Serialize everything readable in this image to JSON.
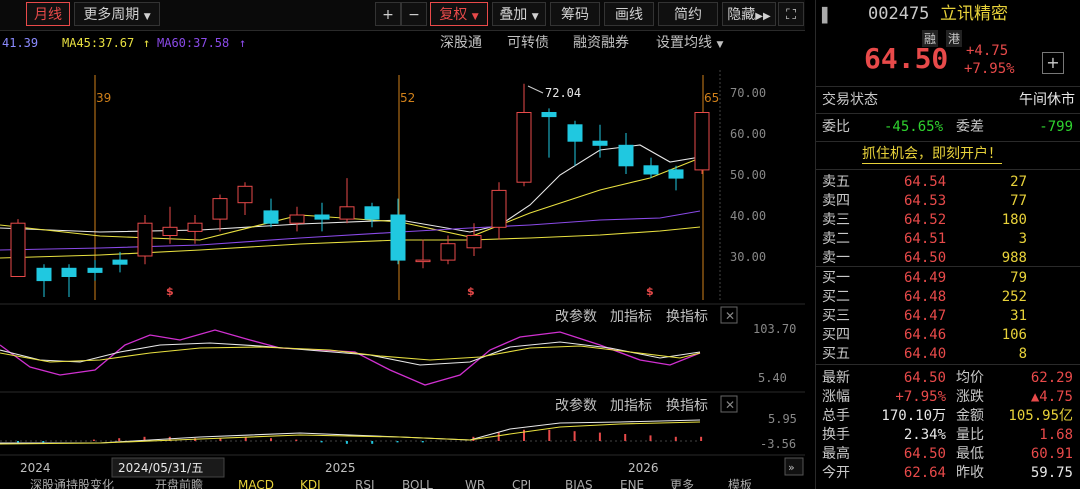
{
  "toolbar": {
    "tab_monthly": "月线",
    "more_periods": "更多周期",
    "plus": "+",
    "minus": "−",
    "fuquan": "复权",
    "diejia": "叠加",
    "chouma": "筹码",
    "huaxian": "画线",
    "jianyue": "简约",
    "yincang": "隐藏",
    "fullscreen": "⛶"
  },
  "ma_line": {
    "ma_prev": "41.39",
    "ma45": "MA45:37.67",
    "ma60": "MA60:37.58",
    "links": [
      "深股通",
      "可转债",
      "融资融券",
      "设置均线"
    ]
  },
  "chart": {
    "price_ticks": [
      "70.00",
      "60.00",
      "50.00",
      "40.00",
      "30.00"
    ],
    "markers": [
      "39",
      "52",
      "65"
    ],
    "peak_label": "72.04",
    "indicator1": {
      "top": "103.70",
      "bottom": "5.40",
      "buttons": [
        "改参数",
        "加指标",
        "换指标"
      ]
    },
    "indicator2": {
      "top": "5.95",
      "bottom": "-3.56",
      "buttons": [
        "改参数",
        "加指标",
        "换指标"
      ]
    },
    "x_axis": [
      "2024",
      "2024/05/31/五",
      "2025",
      "2026"
    ]
  },
  "bottom_tabs": [
    "深股通持股变化",
    "开盘前瞻",
    "MACD",
    "KDJ",
    "RSI",
    "BOLL",
    "WR",
    "CPI",
    "BIAS",
    "ENE",
    "更多",
    "模板"
  ],
  "stock": {
    "code": "002475",
    "name": "立讯精密",
    "badges": [
      "融",
      "港"
    ],
    "price": "64.50",
    "change": "+4.75",
    "change_pct": "+7.95%",
    "trading_status_label": "交易状态",
    "trading_status": "午间休市",
    "weibi_label": "委比",
    "weibi": "-45.65%",
    "weicha_label": "委差",
    "weicha": "-799",
    "banner": "抓住机会，即刻开户！"
  },
  "asks": [
    {
      "label": "卖五",
      "price": "64.54",
      "vol": "27"
    },
    {
      "label": "卖四",
      "price": "64.53",
      "vol": "77"
    },
    {
      "label": "卖三",
      "price": "64.52",
      "vol": "180"
    },
    {
      "label": "卖二",
      "price": "64.51",
      "vol": "3"
    },
    {
      "label": "卖一",
      "price": "64.50",
      "vol": "988"
    }
  ],
  "bids": [
    {
      "label": "买一",
      "price": "64.49",
      "vol": "79"
    },
    {
      "label": "买二",
      "price": "64.48",
      "vol": "252"
    },
    {
      "label": "买三",
      "price": "64.47",
      "vol": "31"
    },
    {
      "label": "买四",
      "price": "64.46",
      "vol": "106"
    },
    {
      "label": "买五",
      "price": "64.40",
      "vol": "8"
    }
  ],
  "stats": [
    {
      "l1": "最新",
      "v1": "64.50",
      "l2": "均价",
      "v2": "62.29",
      "c1": "#e84a4a",
      "c2": "#e84a4a"
    },
    {
      "l1": "涨幅",
      "v1": "+7.95%",
      "l2": "涨跌",
      "v2": "▲4.75",
      "c1": "#e84a4a",
      "c2": "#e84a4a"
    },
    {
      "l1": "总手",
      "v1": "170.10万",
      "l2": "金额",
      "v2": "105.95亿",
      "c1": "#e8e8e8",
      "c2": "#e8d23a"
    },
    {
      "l1": "换手",
      "v1": "2.34%",
      "l2": "量比",
      "v2": "1.68",
      "c1": "#e8e8e8",
      "c2": "#e84a4a"
    },
    {
      "l1": "最高",
      "v1": "64.50",
      "l2": "最低",
      "v2": "60.91",
      "c1": "#e84a4a",
      "c2": "#e84a4a"
    },
    {
      "l1": "今开",
      "v1": "62.64",
      "l2": "昨收",
      "v2": "59.75",
      "c1": "#e84a4a",
      "c2": "#e8e8e8"
    }
  ],
  "colors": {
    "up": "#e84a4a",
    "down": "#2fd22f",
    "bear_candle": "#20c8e0",
    "marker": "#d0801a",
    "ma_white": "#e8e8e8",
    "ma_yellow": "#e8e040",
    "ma_purple": "#8a4ae8",
    "kdj_magenta": "#d030d0"
  }
}
